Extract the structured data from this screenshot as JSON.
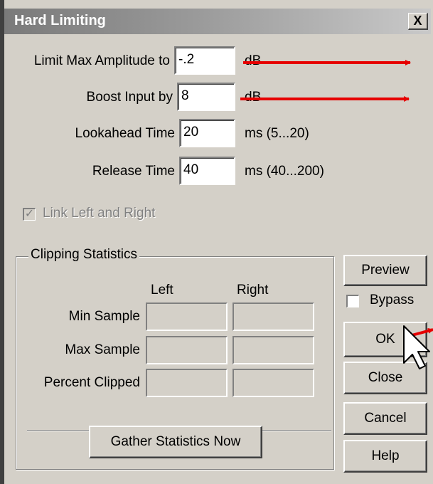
{
  "window": {
    "title": "Hard Limiting",
    "close_label": "X"
  },
  "params": [
    {
      "label": "Limit Max Amplitude to",
      "value": "-.2",
      "unit": "dB"
    },
    {
      "label": "Boost Input by",
      "value": "8",
      "unit": "dB"
    },
    {
      "label": "Lookahead Time",
      "value": "20",
      "unit": "ms (5...20)"
    },
    {
      "label": "Release Time",
      "value": "40",
      "unit": "ms (40...200)"
    }
  ],
  "link": {
    "label": "Link Left and Right",
    "checked": true,
    "enabled": false
  },
  "stats": {
    "group_label": "Clipping Statistics",
    "col_left": "Left",
    "col_right": "Right",
    "rows": [
      "Min Sample",
      "Max Sample",
      "Percent Clipped"
    ],
    "gather_label": "Gather Statistics Now"
  },
  "buttons": {
    "preview": "Preview",
    "bypass": "Bypass",
    "ok": "OK",
    "close": "Close",
    "cancel": "Cancel",
    "help": "Help"
  },
  "annotation_color": "#e60000"
}
